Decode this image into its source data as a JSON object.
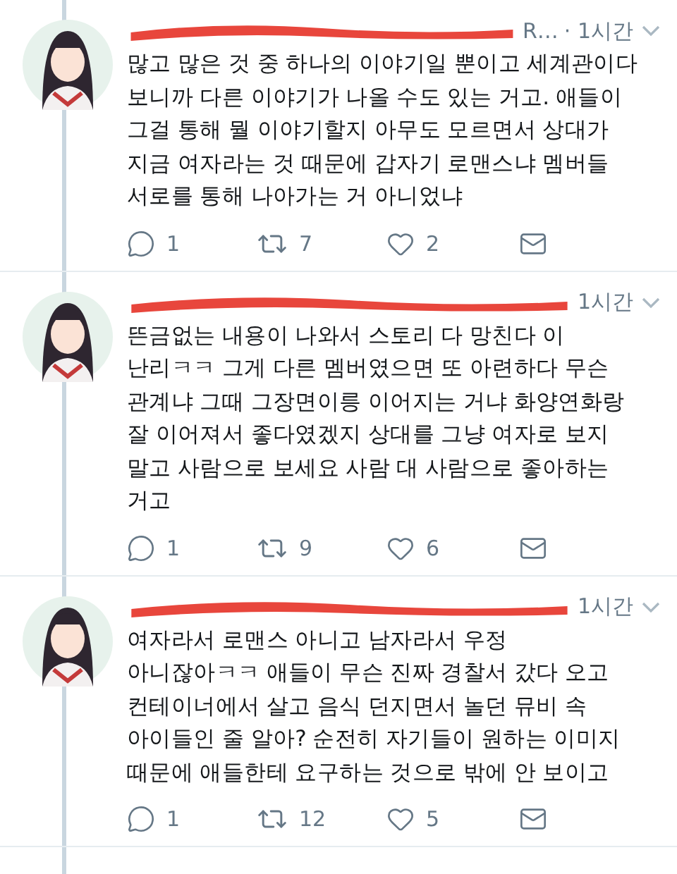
{
  "tweets": [
    {
      "handle_fragment": "R…",
      "time": "· 1시간",
      "text": "많고 많은 것 중 하나의 이야기일 뿐이고 세계관이다\n보니까 다른 이야기가 나올 수도 있는 거고. 애들이\n그걸 통해 뭘 이야기할지 아무도 모르면서 상대가\n지금 여자라는 것 때문에 갑자기 로맨스냐 멤버들\n서로를 통해 나아가는 거 아니었냐",
      "replies": "1",
      "retweets": "7",
      "likes": "2"
    },
    {
      "time": "1시간",
      "text": "뜬금없는 내용이 나와서 스토리 다 망친다 이\n난리ㅋㅋ 그게 다른 멤버였으면 또 아련하다 무슨\n관계냐 그때 그장면이릉 이어지는 거냐 화양연화랑\n잘 이어져서 좋다였겠지 상대를 그냥 여자로 보지\n말고 사람으로 보세요 사람 대 사람으로 좋아하는\n거고",
      "replies": "1",
      "retweets": "9",
      "likes": "6"
    },
    {
      "time": "1시간",
      "text": "여자라서 로맨스 아니고 남자라서 우정\n아니잖아ㅋㅋ 애들이 무슨 진짜 경찰서 갔다 오고\n컨테이너에서 살고 음식 던지면서 놀던 뮤비 속\n아이들인 줄 알아? 순전히 자기들이 원하는 이미지\n때문에 애들한테 요구하는 것으로 밖에 안 보이고",
      "replies": "1",
      "retweets": "12",
      "likes": "5"
    }
  ]
}
